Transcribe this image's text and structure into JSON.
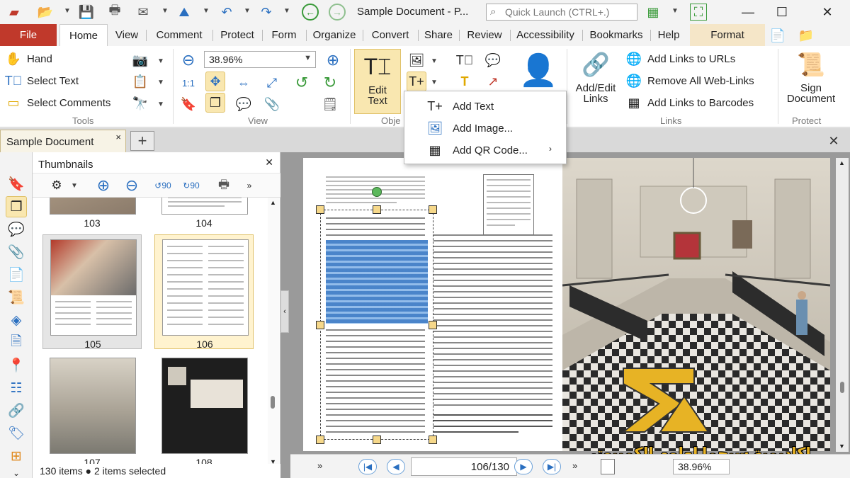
{
  "window": {
    "title": "Sample Document - P...",
    "quick_launch_placeholder": "Quick Launch (CTRL+.)"
  },
  "ribbon_tabs": [
    "File",
    "Home",
    "View",
    "Comment",
    "Protect",
    "Form",
    "Organize",
    "Convert",
    "Share",
    "Review",
    "Accessibility",
    "Bookmarks",
    "Help",
    "Format"
  ],
  "active_tab": "Home",
  "tools_group": {
    "hand": "Hand",
    "select_text": "Select Text",
    "select_comments": "Select Comments",
    "label": "Tools"
  },
  "view_group": {
    "zoom": "38.96%",
    "label": "View"
  },
  "objects_group": {
    "edit_text_line1": "Edit",
    "edit_text_line2": "Text",
    "label": "Obje"
  },
  "links_group": {
    "add_edit_links_line1": "Add/Edit",
    "add_edit_links_line2": "Links",
    "add_links_urls": "Add Links to URLs",
    "remove_web_links": "Remove All Web-Links",
    "add_links_barcodes": "Add Links to Barcodes",
    "label": "Links"
  },
  "protect_group": {
    "sign_line1": "Sign",
    "sign_line2": "Document",
    "label": "Protect"
  },
  "dropdown": {
    "add_text": "Add Text",
    "add_image": "Add Image...",
    "add_qr": "Add QR Code..."
  },
  "doc_tab": {
    "name": "Sample Document",
    "close": "×",
    "new": "+"
  },
  "thumbnails": {
    "title": "Thumbnails",
    "pages": [
      "103",
      "104",
      "105",
      "106",
      "107",
      "108"
    ],
    "status_items": "130 items",
    "status_selected": "2 items selected"
  },
  "navigation": {
    "current_page": "106",
    "total_pages": "130",
    "zoom": "38.96%"
  },
  "watermark": {
    "arabic": "اكاديمية سيجما لعلوم الكمبيوتر"
  },
  "colors": {
    "file_tab": "#c0392b",
    "selection": "#f9e7b0",
    "accent_blue": "#2a6fc0"
  }
}
